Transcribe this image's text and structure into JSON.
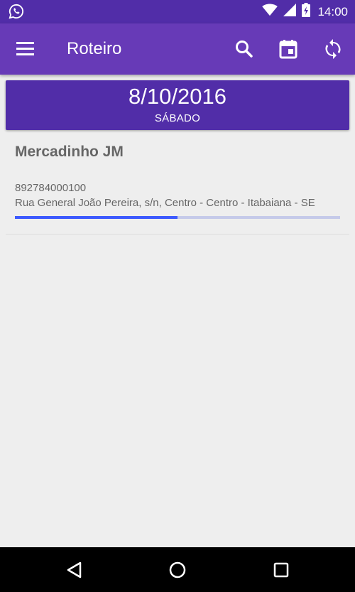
{
  "status_bar": {
    "time": "14:00",
    "icons": [
      "whatsapp-icon",
      "wifi-icon",
      "signal-icon",
      "battery-charging-icon"
    ]
  },
  "app_bar": {
    "title": "Roteiro",
    "actions": [
      "menu-icon",
      "search-icon",
      "calendar-icon",
      "sync-icon"
    ],
    "color": "#673ab7"
  },
  "date_header": {
    "date": "8/10/2016",
    "weekday": "SÁBADO",
    "color": "#512da8"
  },
  "items": [
    {
      "name": "Mercadinho JM",
      "code": "892784000100",
      "address": "Rua General João Pereira, s/n, Centro - Centro - Itabaiana - SE",
      "progress": 0.5,
      "progress_color": "#3d5afe"
    }
  ],
  "nav_bar": {
    "buttons": [
      "back-icon",
      "home-icon",
      "recents-icon"
    ]
  }
}
